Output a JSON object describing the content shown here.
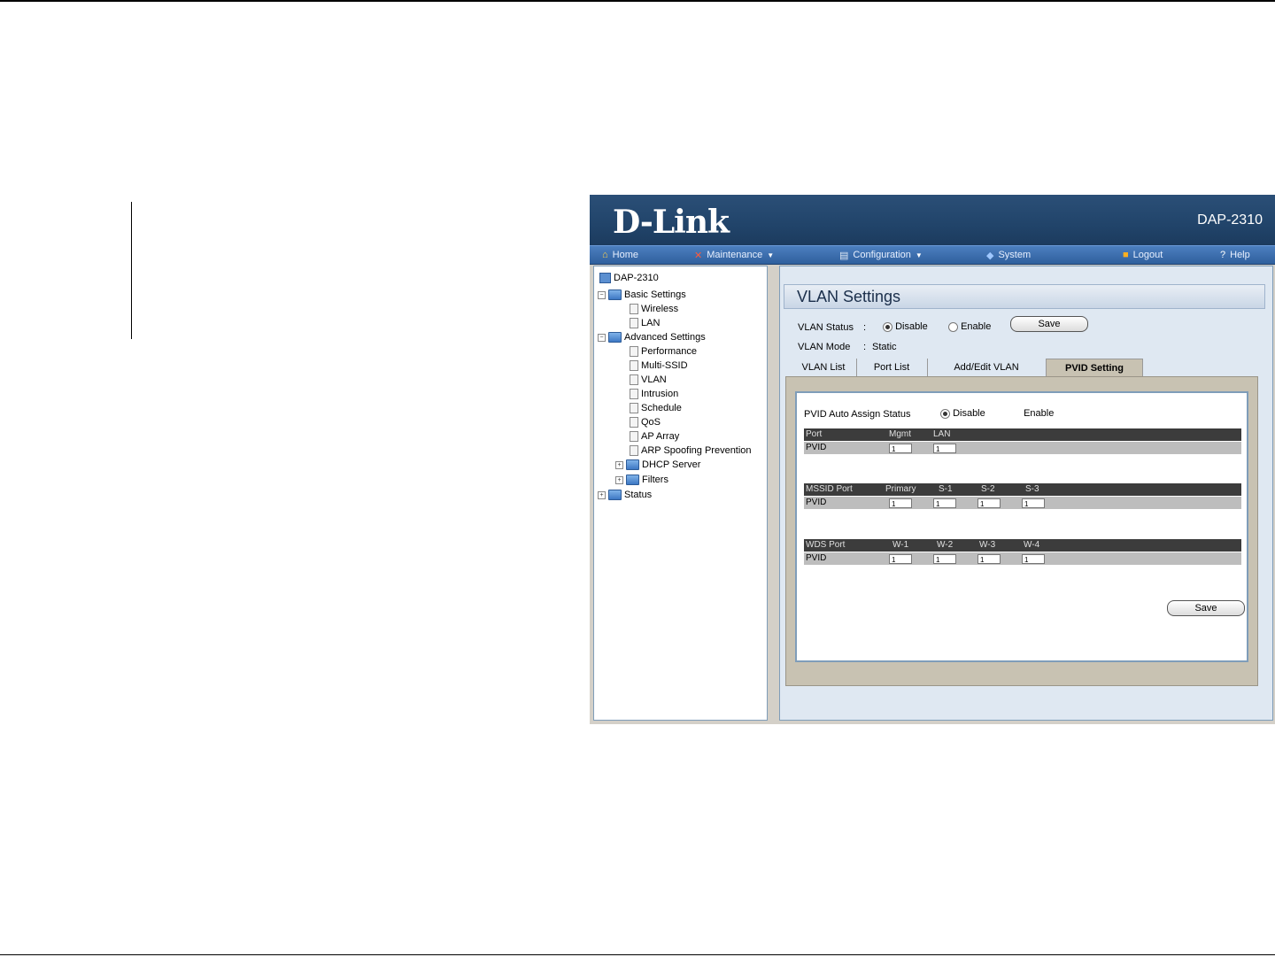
{
  "brand": {
    "logo": "D-Link",
    "model": "DAP-2310"
  },
  "menu": [
    {
      "label": "Home",
      "icon": "home-icon",
      "dropdown": false
    },
    {
      "label": "Maintenance",
      "icon": "tools-icon",
      "dropdown": true
    },
    {
      "label": "Configuration",
      "icon": "config-icon",
      "dropdown": true
    },
    {
      "label": "System",
      "icon": "system-icon",
      "dropdown": false
    },
    {
      "label": "Logout",
      "icon": "logout-icon",
      "dropdown": false
    },
    {
      "label": "Help",
      "icon": "help-icon",
      "dropdown": false
    }
  ],
  "tree": {
    "root": "DAP-2310",
    "basic": {
      "label": "Basic Settings",
      "items": [
        "Wireless",
        "LAN"
      ]
    },
    "advanced": {
      "label": "Advanced Settings",
      "items": [
        "Performance",
        "Multi-SSID",
        "VLAN",
        "Intrusion",
        "Schedule",
        "QoS",
        "AP Array",
        "ARP Spoofing Prevention"
      ],
      "folders": [
        "DHCP Server",
        "Filters"
      ]
    },
    "status": "Status"
  },
  "page": {
    "title": "VLAN Settings",
    "vlan_status_label": "VLAN Status",
    "colon": ":",
    "disable": "Disable",
    "enable": "Enable",
    "save": "Save",
    "vlan_mode_label": "VLAN Mode",
    "vlan_mode_value": "Static",
    "tabs": [
      "VLAN List",
      "Port List",
      "Add/Edit VLAN",
      "PVID Setting"
    ],
    "active_tab": "PVID Setting"
  },
  "pvid": {
    "auto_assign_label": "PVID Auto Assign Status",
    "disable": "Disable",
    "enable": "Enable",
    "port_table": {
      "headers": [
        "Port",
        "Mgmt",
        "LAN"
      ],
      "row_label": "PVID",
      "values": [
        "1",
        "1"
      ]
    },
    "mssid_table": {
      "headers": [
        "MSSID Port",
        "Primary",
        "S-1",
        "S-2",
        "S-3"
      ],
      "row_label": "PVID",
      "values": [
        "1",
        "1",
        "1",
        "1"
      ]
    },
    "wds_table": {
      "headers": [
        "WDS Port",
        "W-1",
        "W-2",
        "W-3",
        "W-4"
      ],
      "row_label": "PVID",
      "values": [
        "1",
        "1",
        "1",
        "1"
      ]
    },
    "save": "Save"
  }
}
